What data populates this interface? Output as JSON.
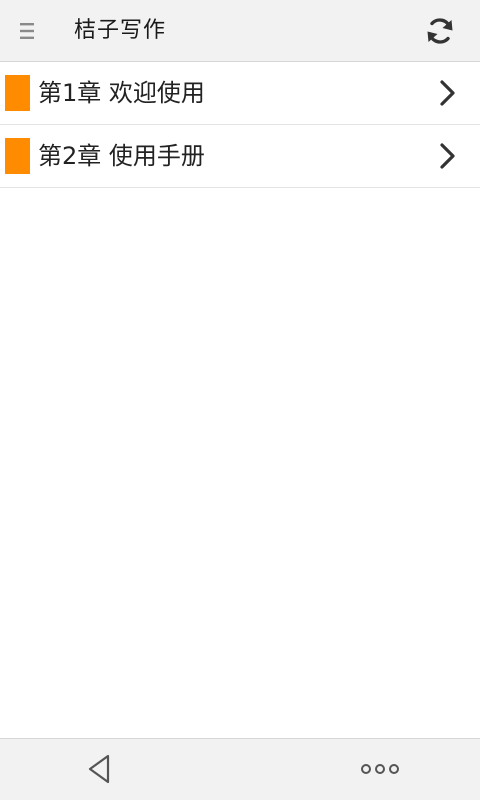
{
  "app_bar": {
    "title": "桔子写作",
    "menu_icon": "menu-icon",
    "refresh_icon": "refresh-icon"
  },
  "chapters": [
    {
      "label": "第1章 欢迎使用"
    },
    {
      "label": "第2章 使用手册"
    }
  ],
  "nav_bar": {
    "back_icon": "back-triangle-icon",
    "more_icon": "more-dots-icon"
  },
  "colors": {
    "accent": "#ff8c00",
    "bar_background": "#f2f2f2",
    "text": "#222222",
    "divider": "#e3e3e3"
  }
}
